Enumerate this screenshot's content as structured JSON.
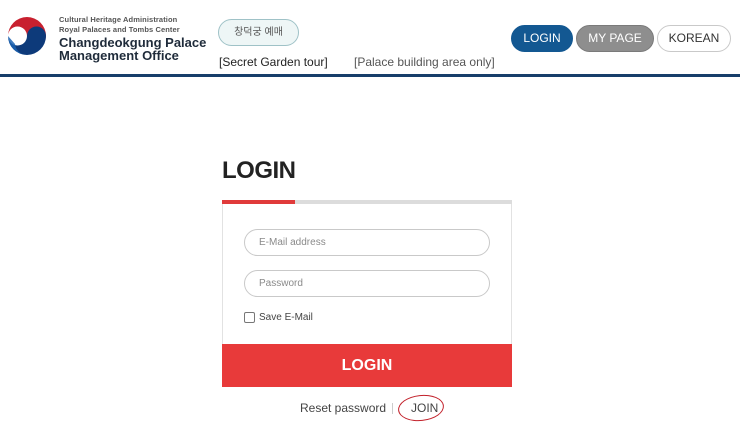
{
  "header": {
    "org_line1": "Cultural Heritage Administration",
    "org_line2": "Royal Palaces and Tombs Center",
    "org_line3": "Changdeokgung Palace",
    "org_line4": "Management Office",
    "reserve_label": "창덕궁 예매",
    "tour_secret_garden": "[Secret Garden tour]",
    "tour_palace_area": "[Palace building area only]",
    "nav": {
      "login": "LOGIN",
      "mypage": "MY PAGE",
      "language": "KOREAN"
    },
    "rule_color": "#173e6a"
  },
  "login": {
    "title": "LOGIN",
    "email_placeholder": "E-Mail address",
    "password_placeholder": "Password",
    "email_value": "",
    "password_value": "",
    "save_email_label": "Save E-Mail",
    "save_email_checked": false,
    "submit_label": "LOGIN",
    "reset_password": "Reset password",
    "join": "JOIN",
    "accent_color": "#e83a3a"
  },
  "icons": {
    "logo": "taegeuk-emblem-icon",
    "checkbox": "checkbox-icon",
    "join_highlight": "hand-drawn-circle"
  }
}
